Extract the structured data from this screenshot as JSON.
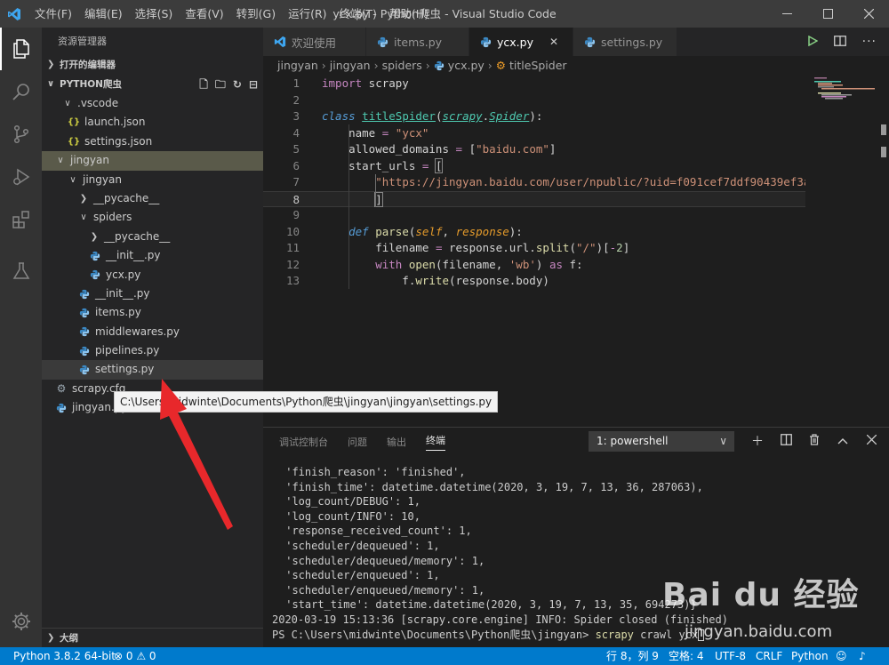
{
  "titlebar": {
    "menu": [
      "文件(F)",
      "编辑(E)",
      "选择(S)",
      "查看(V)",
      "转到(G)",
      "运行(R)",
      "终端(T)",
      "帮助(H)"
    ],
    "title": "ycx.py - Python爬虫 - Visual Studio Code"
  },
  "sidebar": {
    "title": "资源管理器",
    "open_editors": "打开的编辑器",
    "project": "PYTHON爬虫",
    "outline": "大纲",
    "tree": [
      {
        "label": ".vscode",
        "type": "folder",
        "open": true
      },
      {
        "label": "launch.json",
        "type": "json"
      },
      {
        "label": "settings.json",
        "type": "json"
      },
      {
        "label": "jingyan",
        "type": "folder",
        "open": true
      },
      {
        "label": "jingyan",
        "type": "folder",
        "open": true
      },
      {
        "label": "__pycache__",
        "type": "folder",
        "open": false
      },
      {
        "label": "spiders",
        "type": "folder",
        "open": true
      },
      {
        "label": "__pycache__",
        "type": "folder",
        "open": false
      },
      {
        "label": "__init__.py",
        "type": "python"
      },
      {
        "label": "ycx.py",
        "type": "python"
      },
      {
        "label": "__init__.py",
        "type": "python"
      },
      {
        "label": "items.py",
        "type": "python"
      },
      {
        "label": "middlewares.py",
        "type": "python"
      },
      {
        "label": "pipelines.py",
        "type": "python"
      },
      {
        "label": "settings.py",
        "type": "python"
      },
      {
        "label": "scrapy.cfg",
        "type": "gear"
      },
      {
        "label": "jingyan.py",
        "type": "python"
      }
    ]
  },
  "tabs": [
    {
      "label": "欢迎使用",
      "icon": "vscode-icon"
    },
    {
      "label": "items.py",
      "icon": "python-icon"
    },
    {
      "label": "ycx.py",
      "icon": "python-icon",
      "active": true
    },
    {
      "label": "settings.py",
      "icon": "python-icon"
    }
  ],
  "breadcrumb": [
    "jingyan",
    "jingyan",
    "spiders",
    "ycx.py",
    "titleSpider"
  ],
  "editor": {
    "line_numbers": [
      "1",
      "2",
      "3",
      "4",
      "5",
      "6",
      "7",
      "8",
      "9",
      "10",
      "11",
      "12",
      "13"
    ],
    "current_line": 8
  },
  "tooltip": "C:\\Users\\midwinte\\Documents\\Python爬虫\\jingyan\\jingyan\\settings.py",
  "panel": {
    "tabs": [
      "调试控制台",
      "问题",
      "输出",
      "终端"
    ],
    "active_tab": "终端",
    "terminal_select": "1: powershell",
    "terminal_lines": [
      " 'finish_reason': 'finished',",
      " 'finish_time': datetime.datetime(2020, 3, 19, 7, 13, 36, 287063),",
      " 'log_count/DEBUG': 1,",
      " 'log_count/INFO': 10,",
      " 'response_received_count': 1,",
      " 'scheduler/dequeued': 1,",
      " 'scheduler/dequeued/memory': 1,",
      " 'scheduler/enqueued': 1,",
      " 'scheduler/enqueued/memory': 1,",
      " 'start_time': datetime.datetime(2020, 3, 19, 7, 13, 35, 694273)}",
      "2020-03-19 15:13:36 [scrapy.core.engine] INFO: Spider closed (finished)"
    ],
    "prompt": "PS C:\\Users\\midwinte\\Documents\\Python爬虫\\jingyan> ",
    "command": "scrapy",
    "command_args": " crawl ycx"
  },
  "statusbar": {
    "python": "Python 3.8.2 64-bit",
    "problems": "⊗ 0 ⚠ 0",
    "position": "行 8，列 9",
    "spaces": "空格: 4",
    "encoding": "UTF-8",
    "eol": "CRLF",
    "language": "Python"
  },
  "watermark": {
    "logo": "Bai du 经验",
    "url": "jingyan.baidu.com"
  },
  "colors": {
    "accent": "#007acc",
    "arrow": "#e8282b"
  }
}
